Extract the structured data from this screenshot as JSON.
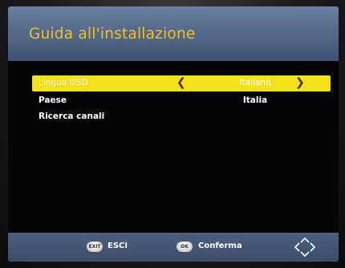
{
  "header": {
    "title": "Guida all'installazione"
  },
  "menu": {
    "items": [
      {
        "label": "Lingua OSD",
        "value": "Italiano",
        "selected": true
      },
      {
        "label": "Paese",
        "value": "Italia",
        "selected": false
      },
      {
        "label": "Ricerca canali",
        "value": "",
        "selected": false
      }
    ]
  },
  "footer": {
    "exit_key": "EXIT",
    "exit_label": "ESCI",
    "ok_key": "OK",
    "ok_label": "Conferma",
    "dpad_icon": "dpad-arrows-icon"
  },
  "colors": {
    "title": "#f2c21a",
    "highlight": "#f3e21b",
    "header": "#566b8c",
    "footer": "#43557a"
  }
}
